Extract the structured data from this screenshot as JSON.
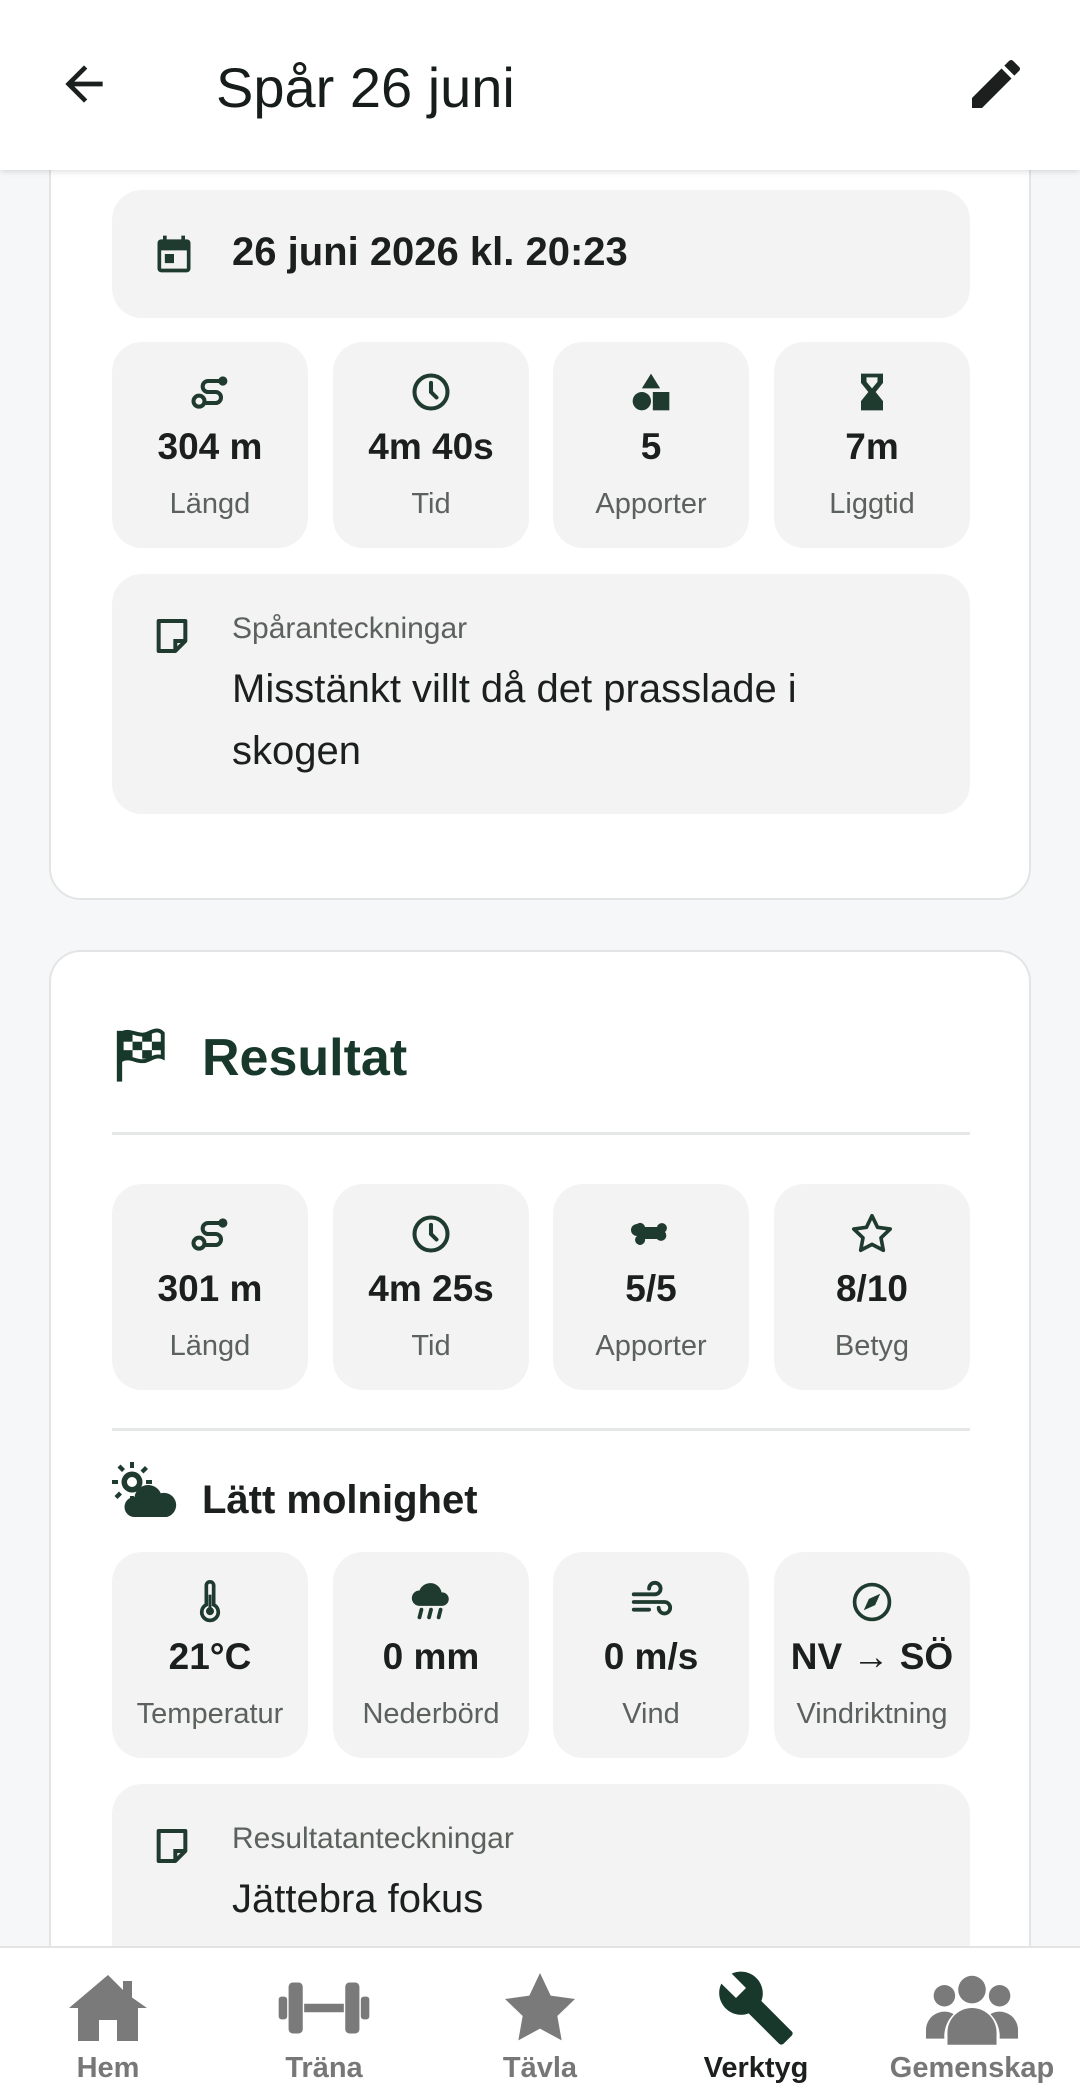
{
  "colors": {
    "accent": "#17382b",
    "icon_dark": "#1f3b30",
    "tile_bg": "#f3f3f3",
    "nav_inactive": "#7a7a7a"
  },
  "header": {
    "title": "Spår 26 juni",
    "back_icon": "arrow-left-icon",
    "edit_icon": "pencil-icon"
  },
  "track": {
    "date_text": "26 juni 2026 kl. 20:23",
    "stats": [
      {
        "icon": "route-icon",
        "value": "304 m",
        "label": "Längd"
      },
      {
        "icon": "clock-icon",
        "value": "4m 40s",
        "label": "Tid"
      },
      {
        "icon": "shapes-icon",
        "value": "5",
        "label": "Apporter"
      },
      {
        "icon": "hourglass-icon",
        "value": "7m",
        "label": "Liggtid"
      }
    ],
    "notes_label": "Spåranteckningar",
    "notes_text": "Misstänkt villt då det prasslade i skogen"
  },
  "result": {
    "heading": "Resultat",
    "stats": [
      {
        "icon": "route-icon",
        "value": "301 m",
        "label": "Längd"
      },
      {
        "icon": "clock-icon",
        "value": "4m 25s",
        "label": "Tid"
      },
      {
        "icon": "bone-icon",
        "value": "5/5",
        "label": "Apporter"
      },
      {
        "icon": "star-outline-icon",
        "value": "8/10",
        "label": "Betyg"
      }
    ],
    "weather_title": "Lätt molnighet",
    "weather": [
      {
        "icon": "thermometer-icon",
        "value": "21°C",
        "label": "Temperatur"
      },
      {
        "icon": "rain-cloud-icon",
        "value": "0 mm",
        "label": "Nederbörd"
      },
      {
        "icon": "wind-icon",
        "value": "0 m/s",
        "label": "Vind"
      },
      {
        "icon": "compass-icon",
        "value": "NV → SÖ",
        "label": "Vindriktning"
      }
    ],
    "notes_label": "Resultatanteckningar",
    "notes_text": "Jättebra fokus"
  },
  "nav": {
    "items": [
      {
        "label": "Hem",
        "icon": "home-icon",
        "active": false
      },
      {
        "label": "Träna",
        "icon": "dumbbell-icon",
        "active": false
      },
      {
        "label": "Tävla",
        "icon": "star-icon",
        "active": false
      },
      {
        "label": "Verktyg",
        "icon": "wrench-icon",
        "active": true
      },
      {
        "label": "Gemenskap",
        "icon": "group-icon",
        "active": false
      }
    ]
  }
}
